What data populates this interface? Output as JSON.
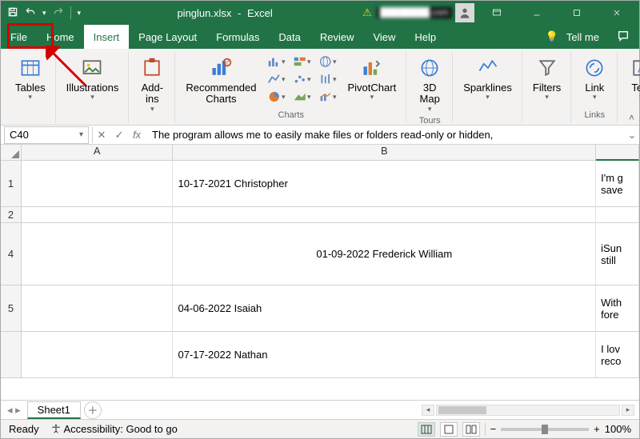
{
  "title": {
    "filename": "pinglun.xlsx",
    "app": "Excel",
    "user_email": "████████.com"
  },
  "tabs": {
    "file": "File",
    "home": "Home",
    "insert": "Insert",
    "page_layout": "Page Layout",
    "formulas": "Formulas",
    "data": "Data",
    "review": "Review",
    "view": "View",
    "help": "Help",
    "tellme": "Tell me"
  },
  "ribbon": {
    "tables": "Tables",
    "illustrations": "Illustrations",
    "addins": "Add-ins",
    "rec_charts": "Recommended Charts",
    "charts": "Charts",
    "pivotchart": "PivotChart",
    "map3d": "3D Map",
    "tours": "Tours",
    "sparklines": "Sparklines",
    "filters": "Filters",
    "link": "Link",
    "links": "Links",
    "text": "Text"
  },
  "formula_bar": {
    "cell_ref": "C40",
    "fx": "fx",
    "value": "The program allows me to easily make files or folders read-only or hidden,"
  },
  "grid": {
    "cols": {
      "A": "A",
      "B": "B"
    },
    "rows": {
      "r1": "1",
      "r2": "2",
      "r4": "4",
      "r5": "5"
    },
    "cells": {
      "B1": "10-17-2021 Christopher",
      "C1": "I'm g\nsave",
      "B4": "01-09-2022 Frederick William",
      "C4": "iSun\nstill",
      "B5": "04-06-2022 Isaiah",
      "C5": "With\nfore",
      "B6": "07-17-2022 Nathan",
      "C6": "I lov\nreco"
    }
  },
  "sheet_tabs": {
    "sheet1": "Sheet1"
  },
  "status": {
    "ready": "Ready",
    "accessibility": "Accessibility: Good to go",
    "zoom": "100%"
  }
}
